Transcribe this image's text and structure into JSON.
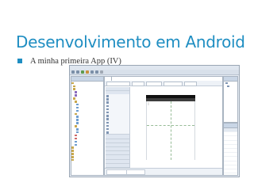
{
  "slide": {
    "title": "Desenvolvimento em Android",
    "bullet": "A minha primeira App (IV)"
  },
  "colors": {
    "title": "#1f8ec2",
    "bullet_marker": "#1f8ec2",
    "ide_frame": "#e9eef5"
  },
  "icons": {
    "bullet": "square-bullet-icon",
    "tree_node": "folder-icon",
    "palette_widget": "widget-icon"
  }
}
